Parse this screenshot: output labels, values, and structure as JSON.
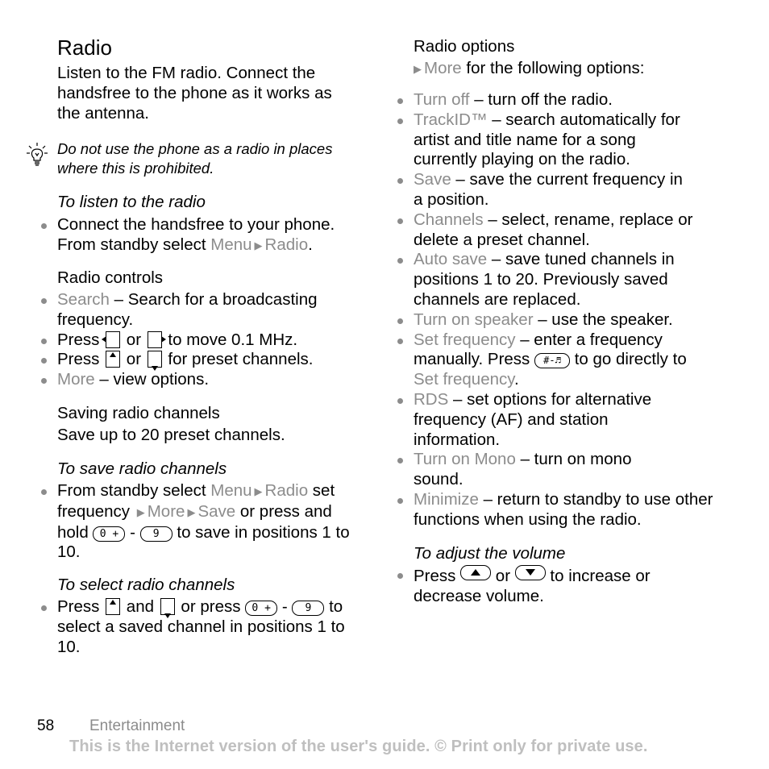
{
  "left": {
    "title": "Radio",
    "intro": "Listen to the FM radio. Connect the handsfree to the phone as it works as the antenna.",
    "tip": {
      "icon": "lightbulb-icon",
      "text": "Do not use the phone as a radio in places where this is prohibited."
    },
    "listen": {
      "heading": "To listen to the radio",
      "line1": "Connect the handsfree to your phone.",
      "line2_pre": "From standby select ",
      "menu": "Menu",
      "radio": "Radio",
      "line2_post": "."
    },
    "controls": {
      "heading": "Radio controls",
      "search_label": "Search",
      "search_text": " – Search for a broadcasting frequency.",
      "press": "Press ",
      "or": " or ",
      "move_text": " to move 0.1 MHz.",
      "preset_text": " for preset channels.",
      "more_label": "More",
      "more_text": " – view options."
    },
    "saving": {
      "heading": "Saving radio channels",
      "text": "Save up to 20 preset channels."
    },
    "save_channels": {
      "heading": "To save radio channels",
      "pre": "From standby select ",
      "menu": "Menu",
      "radio": "Radio",
      "set_freq": " set frequency ",
      "more": "More",
      "save": "Save",
      "or_press": " or press and hold ",
      "key0": "0 +",
      "dash": " - ",
      "key9": "9",
      "post": " to save in positions 1 to 10."
    },
    "select_channels": {
      "heading": "To select radio channels",
      "press": "Press ",
      "and": " and ",
      "or_press": " or press ",
      "key0": "0 +",
      "dash": " - ",
      "key9": "9",
      "post": " to select a saved channel in positions 1 to 10."
    }
  },
  "right": {
    "options_heading": "Radio options",
    "more_label": "More",
    "more_text": " for the following options:",
    "options": [
      {
        "label": "Turn off",
        "text": " – turn off the radio."
      },
      {
        "label": "TrackID™",
        "text": " – search automatically for artist and title name for a song currently playing on the radio."
      },
      {
        "label": "Save",
        "text": " – save the current frequency in a position."
      },
      {
        "label": "Channels",
        "text": " – select, rename, replace or delete a preset channel."
      },
      {
        "label": "Auto save",
        "text": " – save tuned channels in positions 1 to 20. Previously saved channels are replaced."
      },
      {
        "label": "Turn on speaker",
        "text": " – use the speaker."
      },
      {
        "label": "Set frequency",
        "text": " – enter a frequency manually. Press ",
        "key": "#-♬",
        "text2": " to go directly to ",
        "label2": "Set frequency",
        "text3": "."
      },
      {
        "label": "RDS",
        "text": " – set options for alternative frequency (AF) and station information."
      },
      {
        "label": "Turn on Mono",
        "text": " – turn on mono sound."
      },
      {
        "label": "Minimize",
        "text": " – return to standby to use other functions when using the radio."
      }
    ],
    "volume": {
      "heading": "To adjust the volume",
      "press": "Press ",
      "or": " or ",
      "post": " to increase or decrease volume."
    }
  },
  "footer": {
    "page_number": "58",
    "section": "Entertainment",
    "disclaimer": "This is the Internet version of the user's guide. © Print only for private use."
  }
}
